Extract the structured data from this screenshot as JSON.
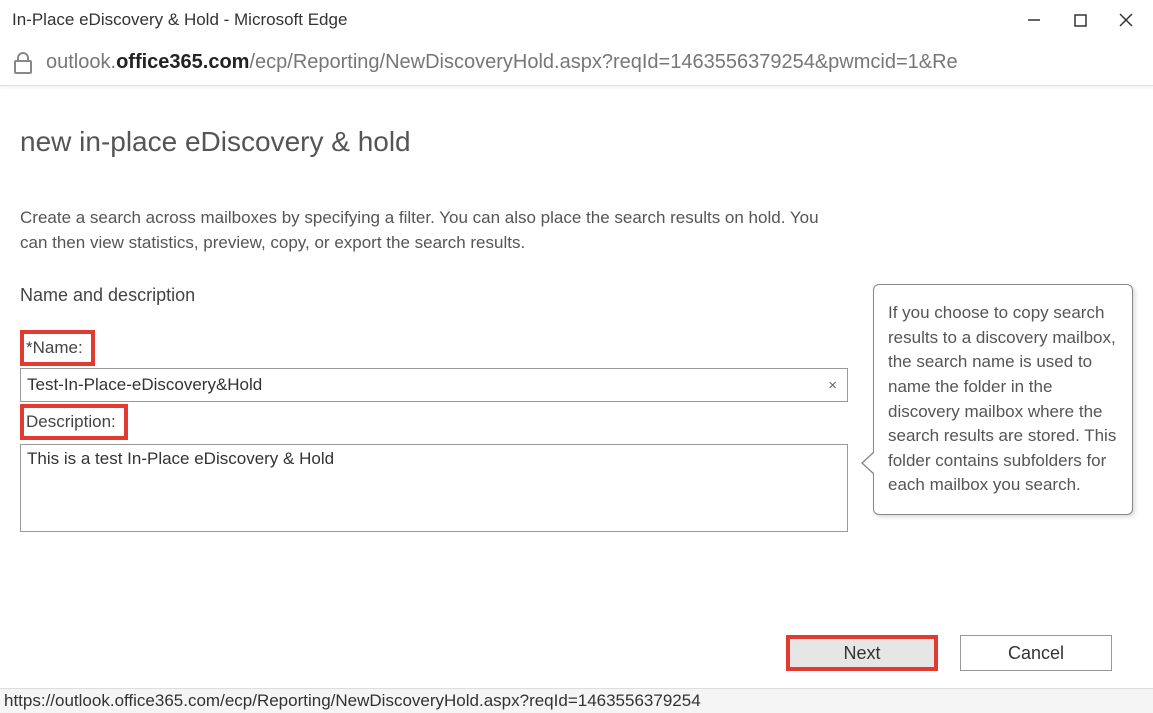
{
  "window": {
    "title": "In-Place eDiscovery & Hold - Microsoft Edge"
  },
  "address": {
    "pre": "outlook.",
    "domain": "office365.com",
    "path": "/ecp/Reporting/NewDiscoveryHold.aspx?reqId=1463556379254&pwmcid=1&Re"
  },
  "page": {
    "title": "new in-place eDiscovery & hold",
    "intro": "Create a search across mailboxes by specifying a filter. You can also place the search results on hold. You can then view statistics, preview, copy, or export the search results.",
    "section_heading": "Name and description"
  },
  "form": {
    "name_label": "*Name:",
    "name_value": "Test-In-Place-eDiscovery&Hold",
    "clear_glyph": "×",
    "desc_label": "Description:",
    "desc_value": "This is a test In-Place eDiscovery & Hold"
  },
  "callout": {
    "text": "If you choose to copy search results to a discovery mailbox, the search name is used to name the folder in the discovery mailbox where the search results are stored. This folder contains subfolders for each mailbox you search."
  },
  "buttons": {
    "next": "Next",
    "cancel": "Cancel"
  },
  "status": {
    "url": "https://outlook.office365.com/ecp/Reporting/NewDiscoveryHold.aspx?reqId=1463556379254"
  }
}
